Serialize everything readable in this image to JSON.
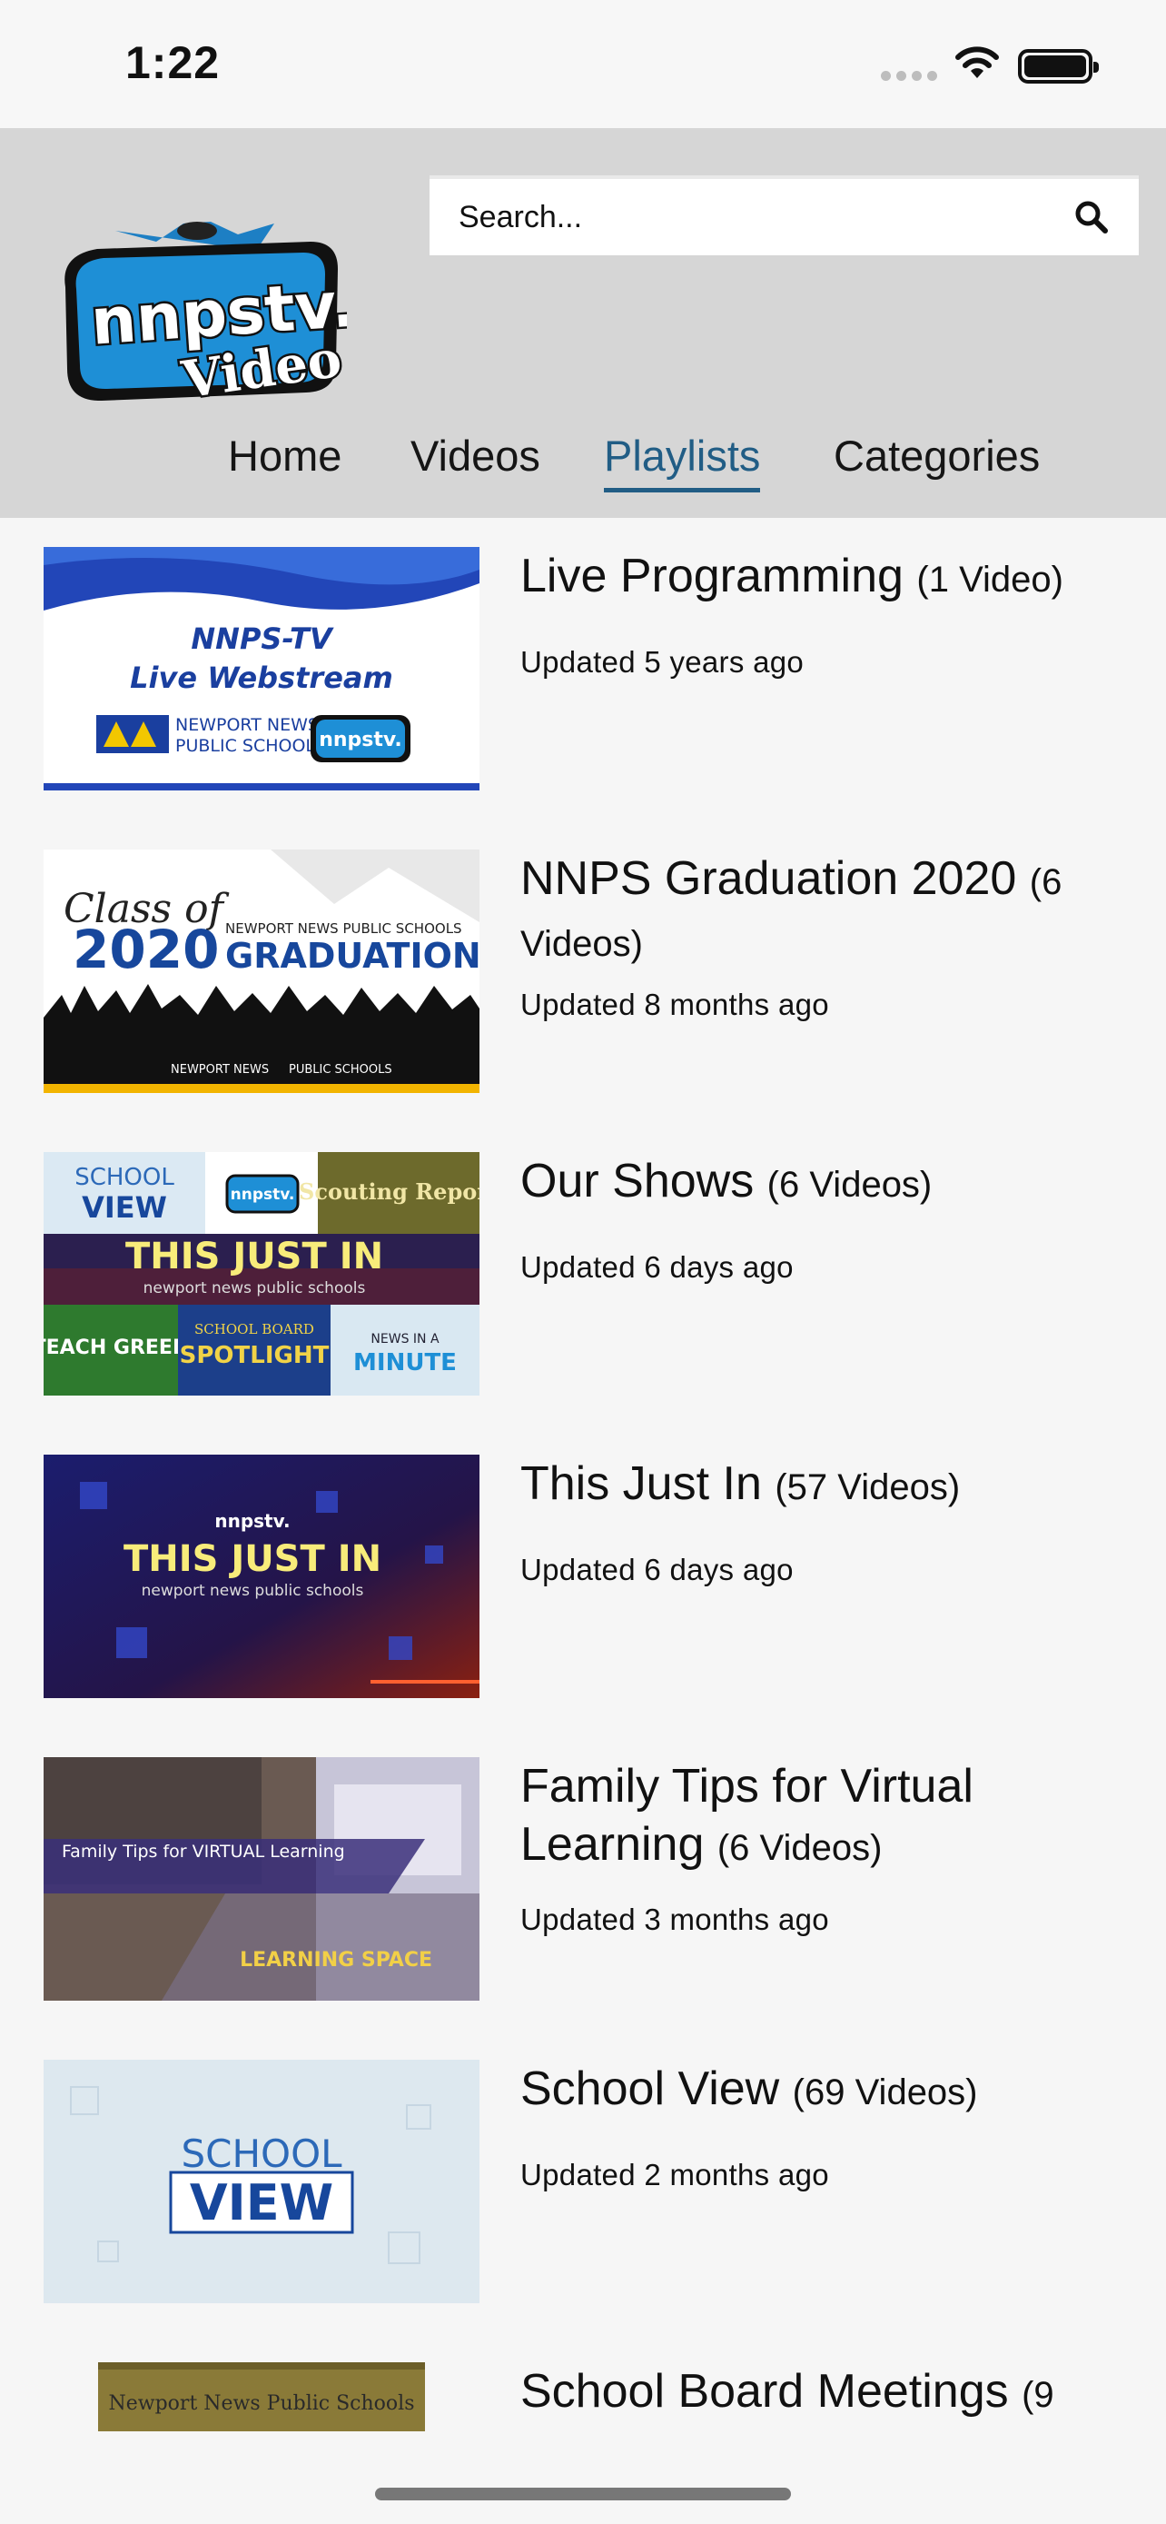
{
  "status_bar": {
    "time": "1:22"
  },
  "header": {
    "logo_text": "nnpstv. Video",
    "search": {
      "placeholder": "Search..."
    },
    "nav": [
      {
        "label": "Home",
        "active": false
      },
      {
        "label": "Videos",
        "active": false
      },
      {
        "label": "Playlists",
        "active": true
      },
      {
        "label": "Categories",
        "active": false
      }
    ]
  },
  "playlists": [
    {
      "title": "Live Programming",
      "count": "(1 Video)",
      "updated": "Updated 5 years ago",
      "thumb_text": [
        "NNPS-TV",
        "Live Webstream",
        "NEWPORT NEWS",
        "PUBLIC SCHOOLS",
        "nnpstv."
      ]
    },
    {
      "title": "NNPS Graduation 2020",
      "count": "(6 Videos)",
      "updated": "Updated 8 months ago",
      "thumb_text": [
        "Class of",
        "2020",
        "NEWPORT NEWS PUBLIC SCHOOLS",
        "GRADUATION",
        "NEWPORT NEWS",
        "PUBLIC SCHOOLS"
      ]
    },
    {
      "title": "Our Shows",
      "count": "(6 Videos)",
      "updated": "Updated 6 days ago",
      "thumb_text": [
        "SCHOOL",
        "VIEW",
        "nnpstv.",
        "Scouting Report",
        "THIS JUST IN",
        "newport news public schools",
        "TEACH GREEN",
        "SCHOOL BOARD",
        "SPOTLIGHT",
        "NEWS IN A",
        "MINUTE"
      ]
    },
    {
      "title": "This Just In",
      "count": "(57 Videos)",
      "updated": "Updated 6 days ago",
      "thumb_text": [
        "nnpstv.",
        "THIS JUST IN",
        "newport news public schools"
      ]
    },
    {
      "title": "Family Tips for Virtual Learning",
      "count": "(6 Videos)",
      "updated": "Updated 3 months ago",
      "thumb_text": [
        "Family Tips for VIRTUAL Learning",
        "LEARNING SPACE"
      ]
    },
    {
      "title": "School View",
      "count": "(69 Videos)",
      "updated": "Updated 2 months ago",
      "thumb_text": [
        "SCHOOL",
        "VIEW"
      ]
    },
    {
      "title": "School Board Meetings",
      "count": "(9",
      "updated": "",
      "thumb_text": [
        "Newport News Public Schools"
      ]
    }
  ],
  "colors": {
    "nav_active": "#215d85",
    "header_bg": "#d6d6d6",
    "page_bg": "#f6f6f6"
  }
}
